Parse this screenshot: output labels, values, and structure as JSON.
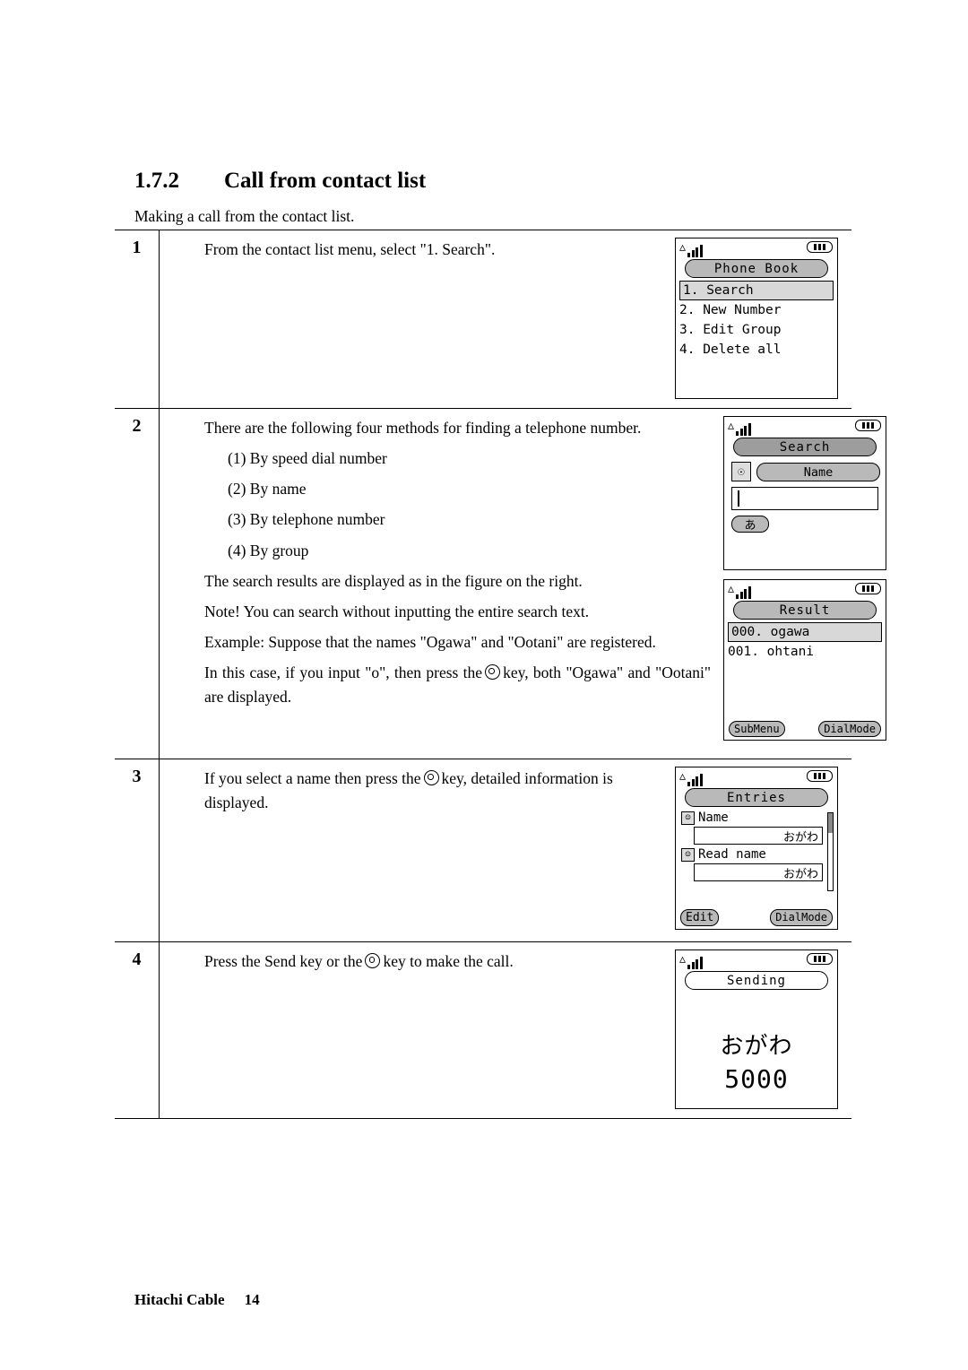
{
  "document": {
    "heading_number": "1.7.2",
    "heading_title": "Call from contact list",
    "intro": "Making a call from the contact list.",
    "footer_text": "Hitachi Cable",
    "footer_page": "14"
  },
  "steps": [
    {
      "num": "1",
      "lines": [
        "From the contact list menu, select \"1. Search\"."
      ],
      "screen": {
        "title": "Phone Book",
        "items": [
          "1. Search",
          "2. New Number",
          "3. Edit Group",
          "4. Delete all"
        ],
        "selected_index": 0
      }
    },
    {
      "num": "2",
      "lines": [
        "There are the following four methods for finding a telephone number.",
        "(1) By speed dial number",
        "(2) By name",
        "(3) By telephone number",
        "(4) By group",
        "The search results are displayed as in the figure on the right.",
        "Note!  You can search without inputting the entire search text.",
        "Example:  Suppose that the names \"Ogawa\" and \"Ootani\" are registered.",
        "In this case, if you input \"o\", then press the",
        "key, both \"Ogawa\" and \"Ootani\" are displayed."
      ],
      "screen_search": {
        "title": "Search",
        "field_label": "Name",
        "field_icon": "person-badge-icon",
        "input_value": "",
        "ime_indicator": "あ"
      },
      "screen_result": {
        "title": "Result",
        "rows": [
          "000. ogawa",
          "001. ohtani"
        ],
        "selected_index": 0,
        "softkey_left": "SubMenu",
        "softkey_right": "DialMode"
      }
    },
    {
      "num": "3",
      "lines": [
        "If you select a name then press the",
        "key, detailed information is displayed."
      ],
      "screen": {
        "title": "Entries",
        "fields": [
          {
            "label": "Name",
            "value": "おがわ"
          },
          {
            "label": "Read name",
            "value": "おがわ"
          }
        ],
        "softkey_left": "Edit",
        "softkey_right": "DialMode",
        "scrollbar": true
      }
    },
    {
      "num": "4",
      "lines": [
        "Press the Send key or the",
        "key to make the call."
      ],
      "screen": {
        "title": "Sending",
        "name": "おがわ",
        "number": "5000"
      }
    }
  ],
  "icons": {
    "signal": "signal-strength-icon",
    "battery": "battery-full-icon",
    "center_key": "center-select-key-icon"
  },
  "colors": {
    "pill_fill": "#b9b9b9",
    "selected_fill": "#d8d8d8",
    "text": "#000000",
    "background": "#ffffff"
  }
}
